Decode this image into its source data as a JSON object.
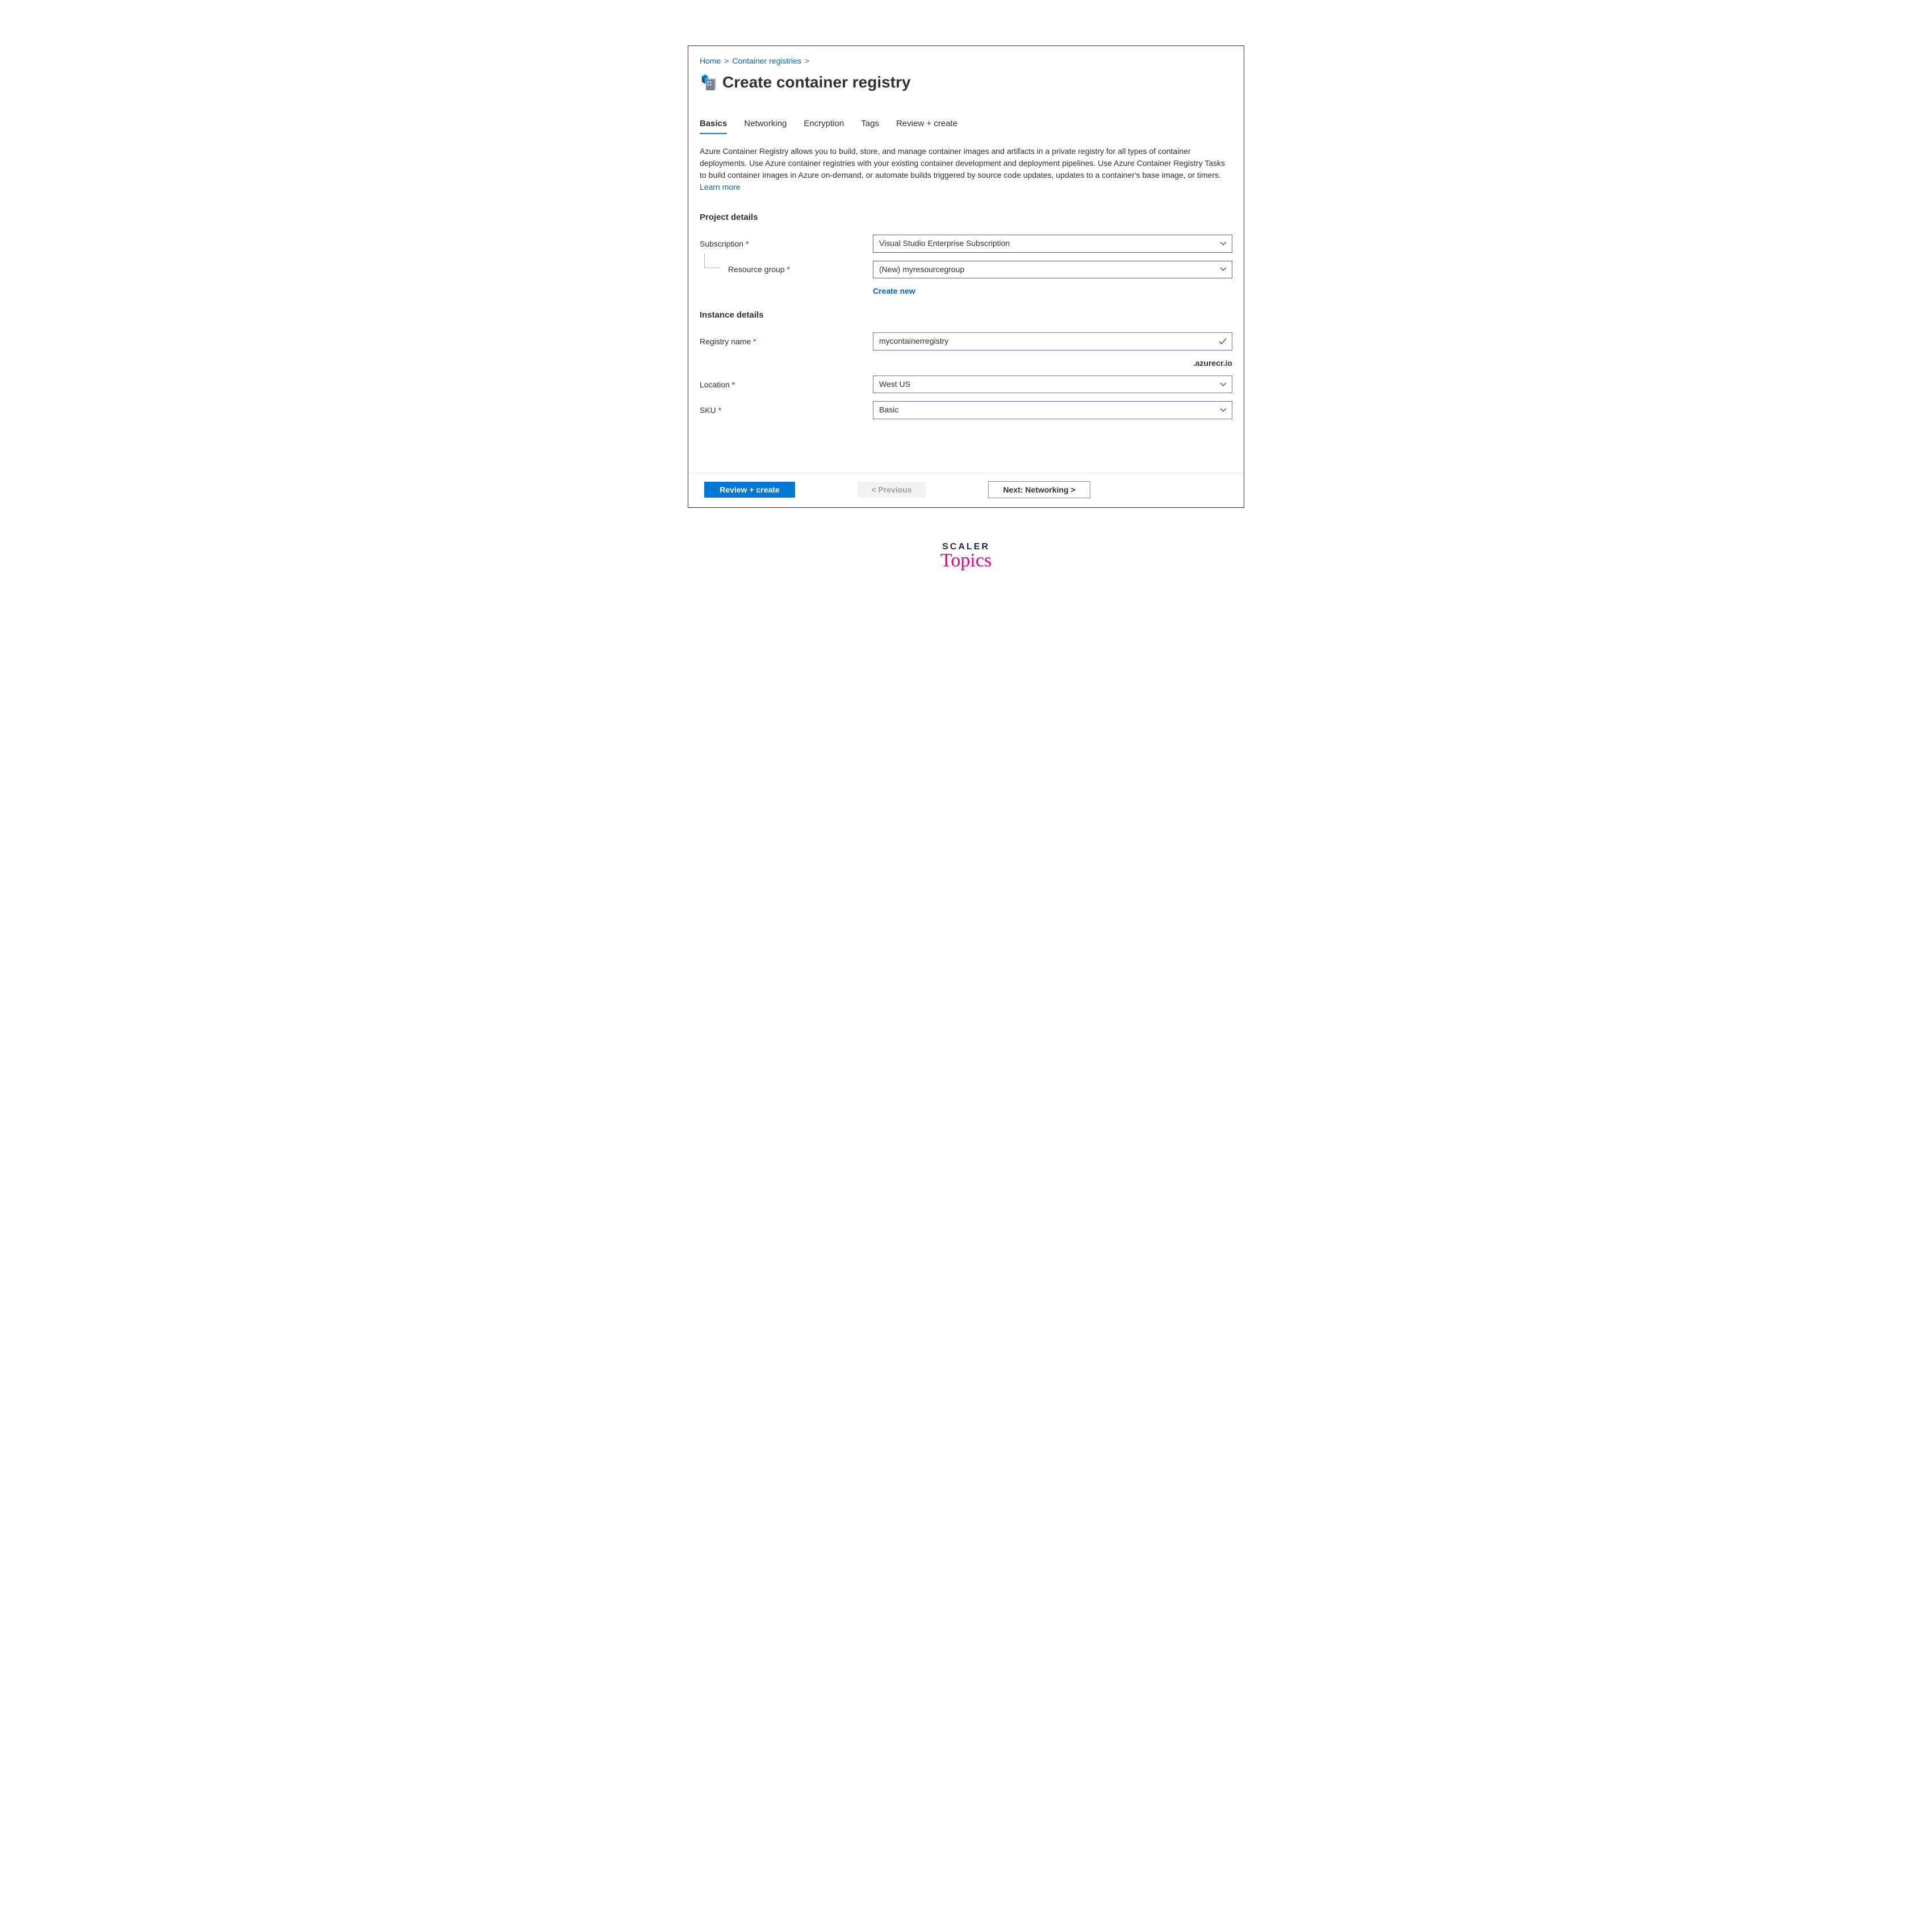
{
  "breadcrumb": {
    "home": "Home",
    "cr": "Container registries"
  },
  "page": {
    "title": "Create container registry"
  },
  "tabs": [
    {
      "label": "Basics",
      "active": true
    },
    {
      "label": "Networking",
      "active": false
    },
    {
      "label": "Encryption",
      "active": false
    },
    {
      "label": "Tags",
      "active": false
    },
    {
      "label": "Review + create",
      "active": false
    }
  ],
  "description": {
    "text": "Azure Container Registry allows you to build, store, and manage container images and artifacts in a private registry for all types of container deployments. Use Azure container registries with your existing container development and deployment pipelines. Use Azure Container Registry Tasks to build container images in Azure on-demand, or automate builds triggered by source code updates, updates to a container's base image, or timers.  ",
    "learn_more": "Learn more"
  },
  "sections": {
    "project": {
      "title": "Project details",
      "subscription_label": "Subscription",
      "subscription_value": "Visual Studio Enterprise Subscription",
      "resource_group_label": "Resource group",
      "resource_group_value": "(New) myresourcegroup",
      "create_new": "Create new"
    },
    "instance": {
      "title": "Instance details",
      "registry_name_label": "Registry name",
      "registry_name_value": "mycontainerregistry",
      "registry_suffix": ".azurecr.io",
      "location_label": "Location",
      "location_value": "West US",
      "sku_label": "SKU",
      "sku_value": "Basic"
    }
  },
  "footer": {
    "review": "Review + create",
    "previous": "< Previous",
    "next": "Next: Networking >"
  },
  "brand": {
    "line1": "SCALER",
    "line2": "Topics"
  }
}
